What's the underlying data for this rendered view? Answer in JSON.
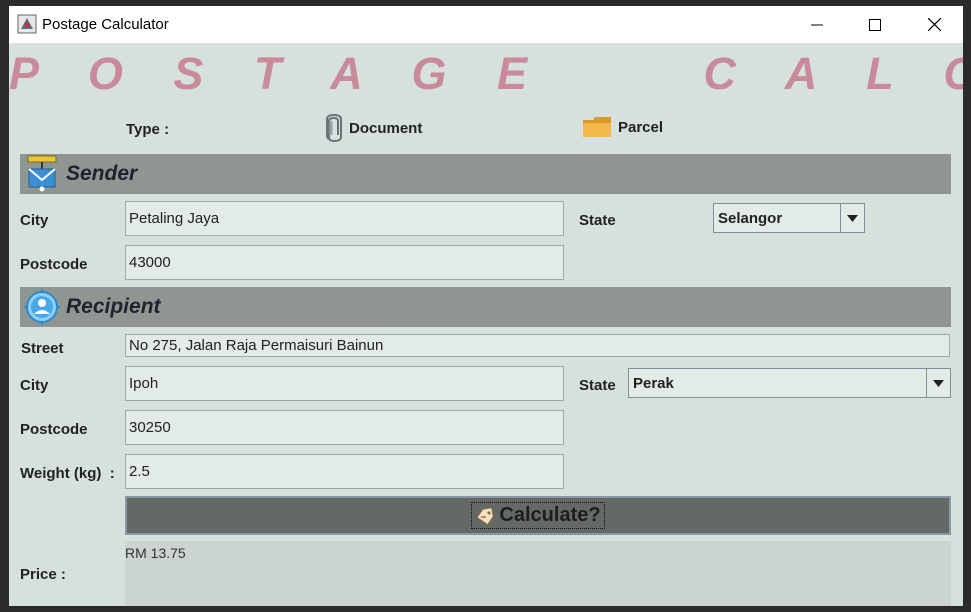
{
  "window": {
    "title": "Postage Calculator"
  },
  "banner": {
    "title": "P O S T A G E     C A L C U L A T O R"
  },
  "type": {
    "label": "Type :",
    "options": [
      "Document",
      "Parcel"
    ]
  },
  "sender": {
    "section_title": "Sender",
    "city_label": "City",
    "city_value": "Petaling Jaya",
    "state_label": "State",
    "state_value": "Selangor",
    "postcode_label": "Postcode",
    "postcode_value": "43000"
  },
  "recipient": {
    "section_title": "Recipient",
    "street_label": "Street",
    "street_value": "No 275, Jalan Raja Permaisuri Bainun",
    "city_label": "City",
    "city_value": "Ipoh",
    "state_label": "State",
    "state_value": "Perak",
    "postcode_label": "Postcode",
    "postcode_value": "30250"
  },
  "weight": {
    "label": "Weight (kg)  :",
    "value": "2.5"
  },
  "calculate_label": "Calculate?",
  "price": {
    "label": "Price :",
    "value": "RM 13.75"
  },
  "colors": {
    "banner": "#c98a9c",
    "background": "#d6e0dc",
    "section_bar": "#8f9692",
    "calculate_button": "#646966"
  }
}
